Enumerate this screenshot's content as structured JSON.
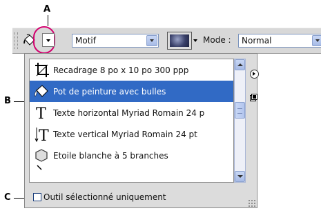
{
  "callouts": {
    "a": "A",
    "b": "B",
    "c": "C"
  },
  "options_bar": {
    "tool_icon": "paint-bucket-icon",
    "fill_select": {
      "value": "Motif"
    },
    "pattern_swatch_icon": "pattern-swatch-icon",
    "mode_label": "Mode :",
    "mode_select": {
      "value": "Normal"
    }
  },
  "preset_picker": {
    "items": [
      {
        "label": "Recadrage 8 po x 10 po 300 ppp",
        "icon": "crop-icon"
      },
      {
        "label": "Pot de peinture avec bulles",
        "icon": "paint-bucket-icon",
        "selected": true
      },
      {
        "label": "Texte horizontal Myriad Romain 24 p",
        "icon": "horizontal-type-icon"
      },
      {
        "label": "Texte vertical Myriad Romain 24 pt",
        "icon": "vertical-type-icon"
      },
      {
        "label": "Etoile blanche à 5 branches",
        "icon": "polygon-icon"
      }
    ],
    "current_tool_only_label": "Outil sélectionné uniquement"
  },
  "colors": {
    "selection": "#316ac5",
    "callout_ring": "#d2006e"
  }
}
